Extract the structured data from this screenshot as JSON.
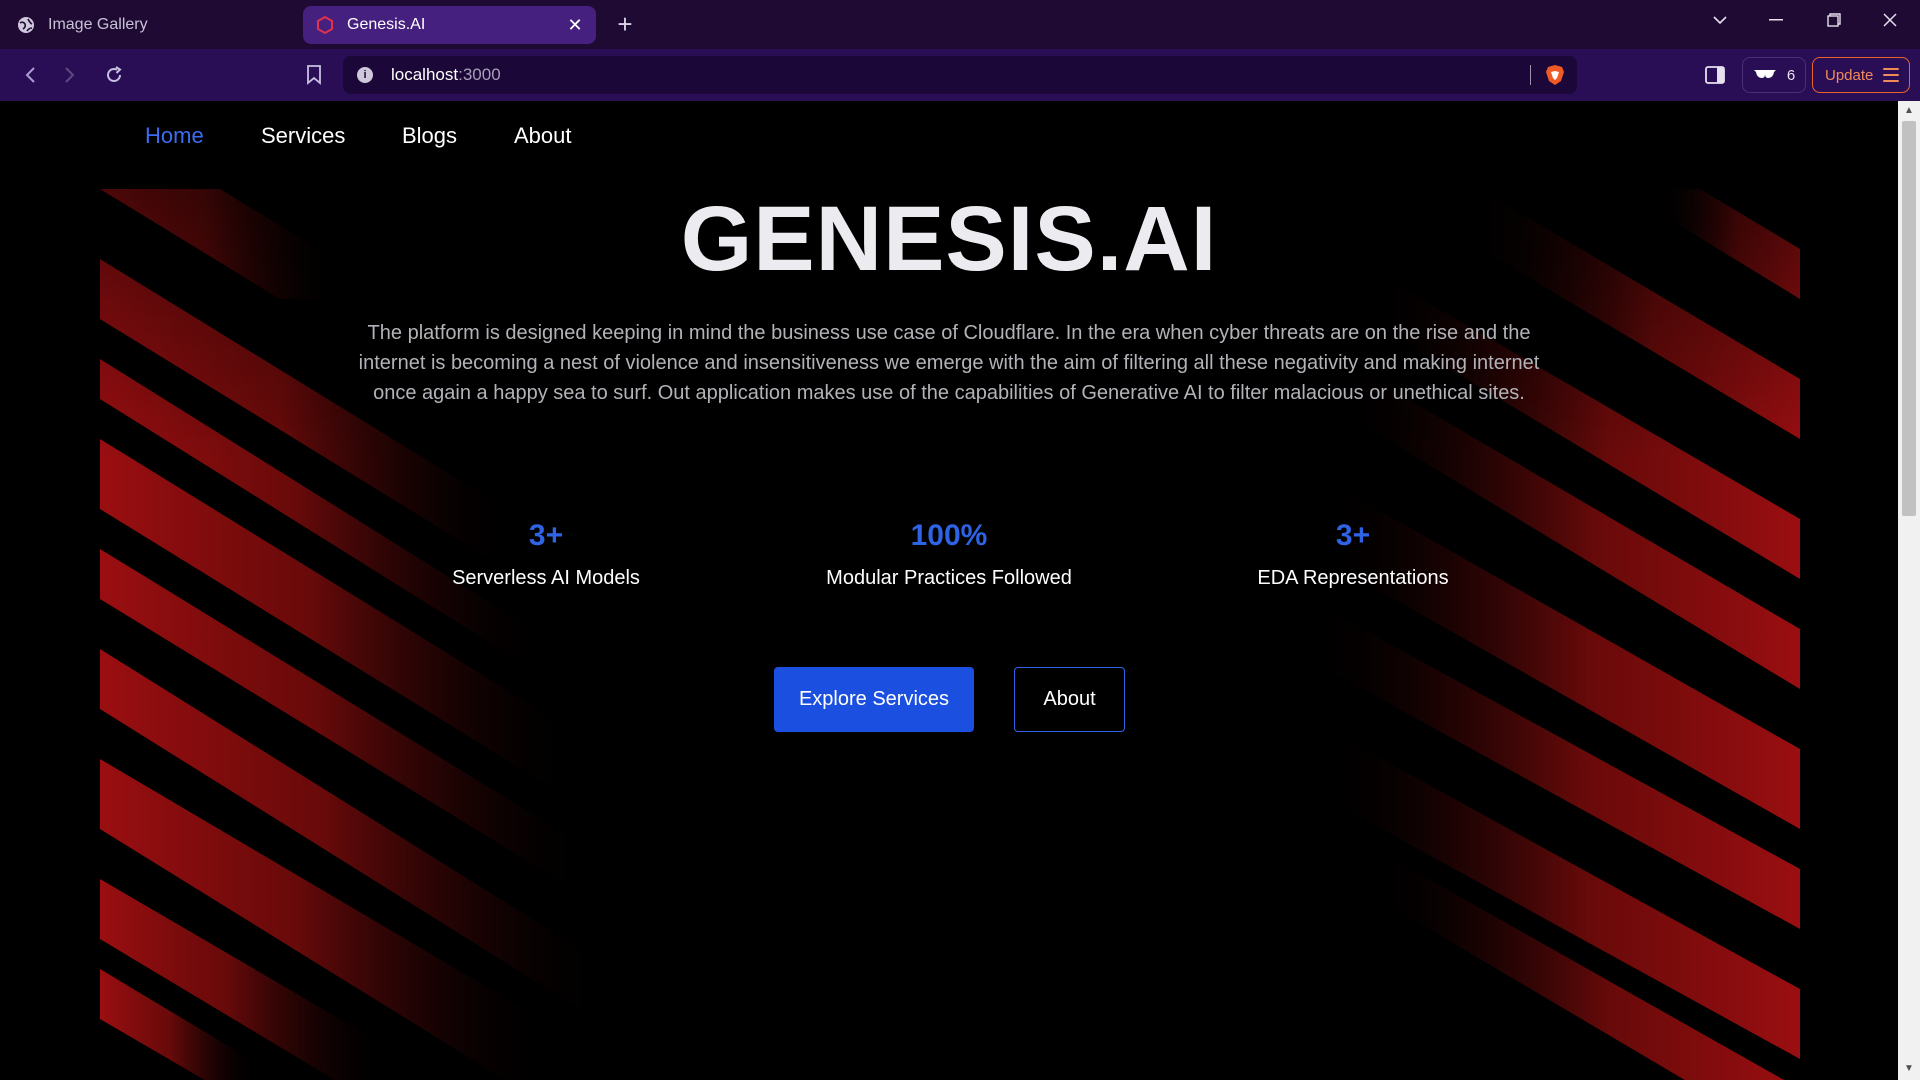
{
  "browser": {
    "tabs": [
      {
        "title": "Image Gallery",
        "active": false,
        "icon": "globe-icon"
      },
      {
        "title": "Genesis.AI",
        "active": true,
        "icon": "hexagon-icon"
      }
    ],
    "address": {
      "host": "localhost",
      "port": ":3000"
    },
    "rewards_count": "6",
    "update_label": "Update"
  },
  "nav": {
    "items": [
      {
        "label": "Home",
        "active": true
      },
      {
        "label": "Services",
        "active": false
      },
      {
        "label": "Blogs",
        "active": false
      },
      {
        "label": "About",
        "active": false
      }
    ]
  },
  "hero": {
    "title": "GENESIS.AI",
    "description": "The platform is designed keeping in mind the business use case of Cloudflare. In the era when cyber threats are on the rise and the internet is becoming a nest of violence and insensitiveness we emerge with the aim of filtering all these negativity and making internet once again a happy sea to surf. Out application makes use of the capabilities of Generative AI to filter malacious or unethical sites."
  },
  "stats": [
    {
      "value": "3+",
      "label": "Serverless AI Models"
    },
    {
      "value": "100%",
      "label": "Modular Practices Followed"
    },
    {
      "value": "3+",
      "label": "EDA Representations"
    }
  ],
  "actions": {
    "primary_label": "Explore Services",
    "secondary_label": "About"
  },
  "colors": {
    "accent_blue": "#2f63e6",
    "chrome_bg": "#2a0e55",
    "stripe_red": "#8b0d0d",
    "update_orange": "#e8642c"
  }
}
